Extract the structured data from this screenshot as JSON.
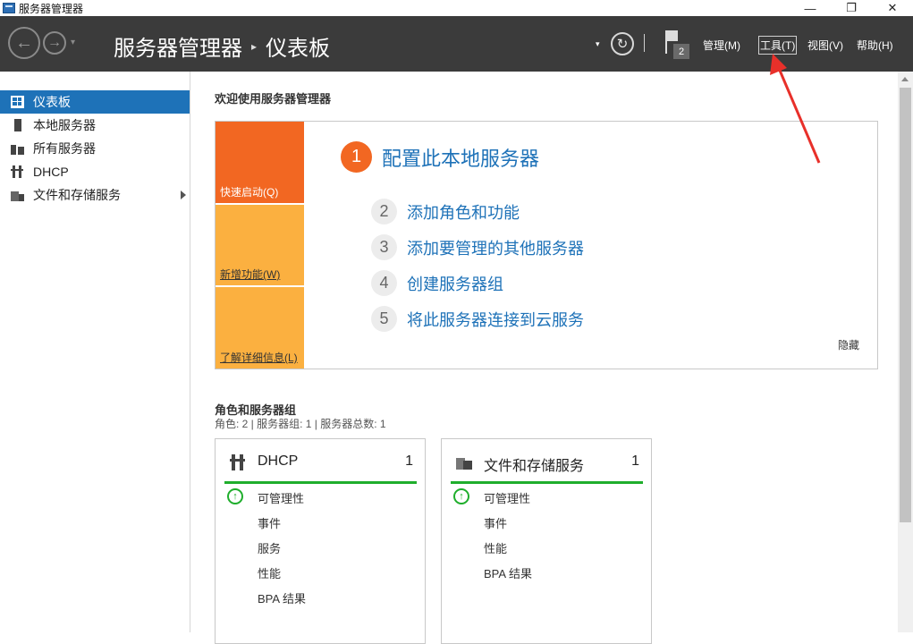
{
  "window": {
    "title": "服务器管理器",
    "minimize": "—",
    "restore": "❐",
    "close": "✕"
  },
  "header": {
    "back_icon": "←",
    "forward_icon": "→",
    "dropdown_icon": "▾",
    "breadcrumb_root": "服务器管理器",
    "breadcrumb_sep": "▸",
    "breadcrumb_current": "仪表板",
    "refresh_icon": "↻",
    "separator": "|",
    "notification_count": "2",
    "menu": {
      "manage": "管理(M)",
      "tools": "工具(T)",
      "view": "视图(V)",
      "help": "帮助(H)"
    }
  },
  "sidebar": {
    "items": [
      {
        "label": "仪表板",
        "icon": "dashboard-icon",
        "active": true
      },
      {
        "label": "本地服务器",
        "icon": "server-icon",
        "active": false
      },
      {
        "label": "所有服务器",
        "icon": "servers-icon",
        "active": false
      },
      {
        "label": "DHCP",
        "icon": "dhcp-icon",
        "active": false
      },
      {
        "label": "文件和存储服务",
        "icon": "files-icon",
        "active": false
      }
    ]
  },
  "main": {
    "welcome_title": "欢迎使用服务器管理器",
    "tiles": {
      "quick_start": "快速启动(Q)",
      "whats_new": "新增功能(W)",
      "learn_more": "了解详细信息(L)"
    },
    "steps": [
      {
        "num": "1",
        "label": "配置此本地服务器"
      },
      {
        "num": "2",
        "label": "添加角色和功能"
      },
      {
        "num": "3",
        "label": "添加要管理的其他服务器"
      },
      {
        "num": "4",
        "label": "创建服务器组"
      },
      {
        "num": "5",
        "label": "将此服务器连接到云服务"
      }
    ],
    "hide": "隐藏",
    "roles_title": "角色和服务器组",
    "roles_summary": "角色: 2 | 服务器组: 1 | 服务器总数: 1",
    "cards": [
      {
        "title": "DHCP",
        "count": "1",
        "rows": [
          "可管理性",
          "事件",
          "服务",
          "性能",
          "BPA 结果"
        ]
      },
      {
        "title": "文件和存储服务",
        "count": "1",
        "rows": [
          "可管理性",
          "事件",
          "性能",
          "BPA 结果"
        ]
      }
    ],
    "status_icon": "↑"
  },
  "colors": {
    "header_bg": "#3b3b3b",
    "accent_blue": "#1e72b8",
    "orange": "#f26722",
    "amber": "#fbb040",
    "green": "#1fae2c",
    "annotation_red": "#e8302a"
  }
}
